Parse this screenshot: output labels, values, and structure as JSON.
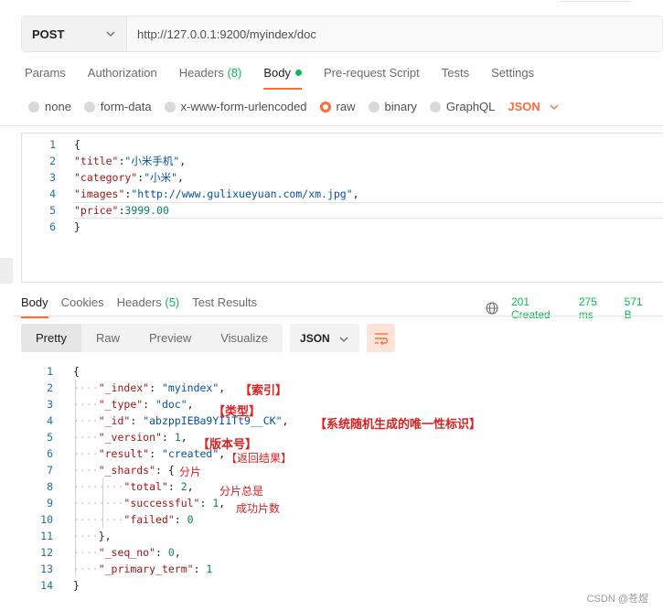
{
  "request": {
    "method": "POST",
    "url": "http://127.0.0.1:9200/myindex/doc"
  },
  "request_tabs": [
    {
      "label": "Params"
    },
    {
      "label": "Authorization"
    },
    {
      "label": "Headers",
      "count": "(8)"
    },
    {
      "label": "Body",
      "active": true
    },
    {
      "label": "Pre-request Script"
    },
    {
      "label": "Tests"
    },
    {
      "label": "Settings"
    }
  ],
  "body_types": [
    "none",
    "form-data",
    "x-www-form-urlencoded",
    "raw",
    "binary",
    "GraphQL"
  ],
  "body_type_selected": "raw",
  "body_format": "JSON",
  "request_body": {
    "line_numbers": [
      "1",
      "2",
      "3",
      "4",
      "5",
      "6"
    ],
    "lines": {
      "l1": "{",
      "l2_key": "\"title\"",
      "l2_val": "\"小米手机\"",
      "l3_key": "\"category\"",
      "l3_val": "\"小米\"",
      "l4_key": "\"images\"",
      "l4_val": "\"http://www.gulixueyuan.com/xm.jpg\"",
      "l5_key": "\"price\"",
      "l5_val": "3999.00",
      "l6": "}"
    }
  },
  "response_tabs": [
    {
      "label": "Body",
      "active": true
    },
    {
      "label": "Cookies"
    },
    {
      "label": "Headers",
      "count": "(5)"
    },
    {
      "label": "Test Results"
    }
  ],
  "response_meta": {
    "status": "201 Created",
    "time": "275 ms",
    "size": "571 B"
  },
  "view_modes": [
    "Pretty",
    "Raw",
    "Preview",
    "Visualize"
  ],
  "view_selected": "Pretty",
  "response_format": "JSON",
  "response_body": {
    "line_numbers": [
      "1",
      "2",
      "3",
      "4",
      "5",
      "6",
      "7",
      "8",
      "9",
      "10",
      "11",
      "12",
      "13",
      "14"
    ],
    "lines": {
      "l1": "{",
      "l2_key": "\"_index\"",
      "l2_val": "\"myindex\"",
      "l3_key": "\"_type\"",
      "l3_val": "\"doc\"",
      "l4_key": "\"_id\"",
      "l4_val": "\"abzppIEBa9YI1Tt9__CK\"",
      "l5_key": "\"_version\"",
      "l5_val": "1",
      "l6_key": "\"result\"",
      "l6_val": "\"created\"",
      "l7_key": "\"_shards\"",
      "l7_val": "{",
      "l8_key": "\"total\"",
      "l8_val": "2",
      "l9_key": "\"successful\"",
      "l9_val": "1",
      "l10_key": "\"failed\"",
      "l10_val": "0",
      "l11": "},",
      "l12_key": "\"_seq_no\"",
      "l12_val": "0",
      "l13_key": "\"_primary_term\"",
      "l13_val": "1",
      "l14": "}"
    }
  },
  "annotations": {
    "index": "【索引】",
    "type": "【类型】",
    "id": "【系统随机生成的唯一性标识】",
    "version": "【版本号】",
    "result": "【返回结果】",
    "shards": "分片",
    "total": "分片总是",
    "successful": "成功片数"
  },
  "watermark": "CSDN @苍煜",
  "colors": {
    "accent": "#ff6c37",
    "success": "#0cbb52",
    "annotation": "#e02020"
  }
}
